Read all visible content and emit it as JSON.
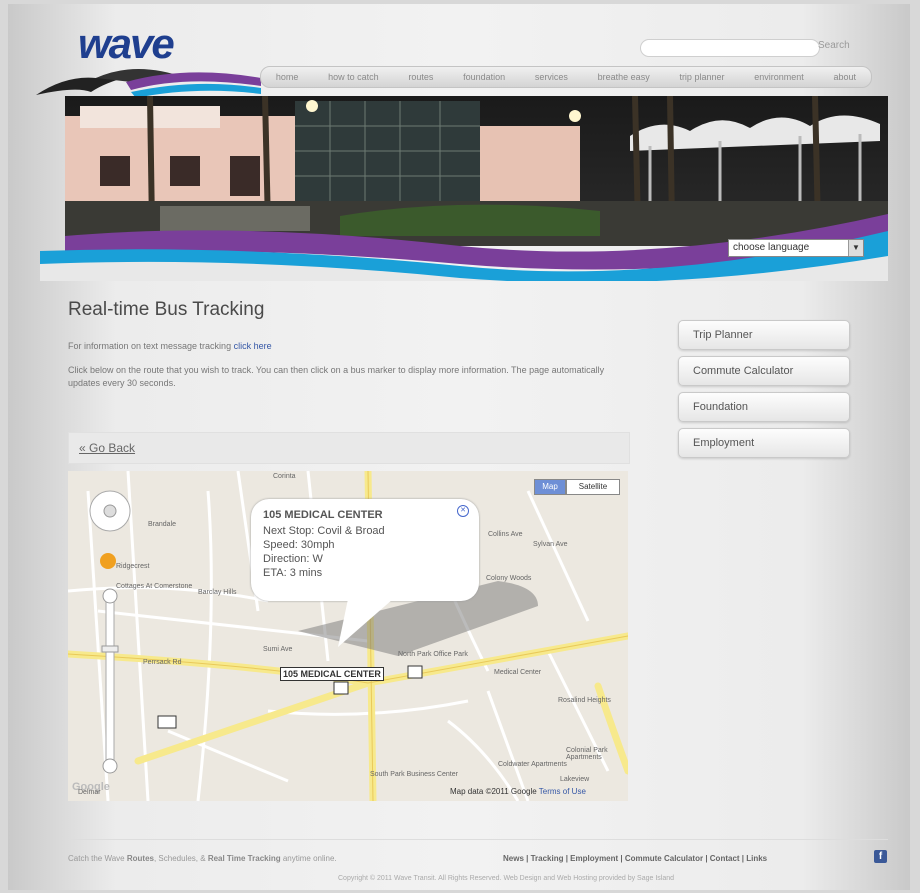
{
  "header": {
    "logo_text": "wave",
    "search_label": "Search",
    "nav_items": [
      "home",
      "how to catch",
      "routes",
      "foundation",
      "services",
      "breathe easy",
      "trip planner",
      "environment",
      "about"
    ]
  },
  "banner": {
    "language_select": "choose language"
  },
  "main": {
    "title": "Real-time Bus Tracking",
    "info_prefix": "For information on text message tracking",
    "info_link": "click here",
    "instructions": "Click below on the route that you wish to track. You can then click on a bus marker to display more information. The page automatically updates every 30 seconds.",
    "go_back": "« Go Back"
  },
  "sidebar": {
    "buttons": [
      "Trip Planner",
      "Commute Calculator",
      "Foundation",
      "Employment"
    ]
  },
  "map": {
    "map_type": [
      "Map",
      "Satellite"
    ],
    "popup": {
      "title": "105 MEDICAL CENTER",
      "next_stop": "Next Stop: Covil & Broad",
      "speed": "Speed: 30mph",
      "direction": "Direction: W",
      "eta": "ETA: 3 mins"
    },
    "bus_label": "105 MEDICAL CENTER",
    "google_logo": "Google",
    "map_data": "Map data ©2011 Google",
    "terms": "Terms of Use",
    "labels": [
      "Corinta",
      "Brandale",
      "Ridgecrest",
      "Collins Ave",
      "Colony Woods",
      "Sylvan Ave",
      "Cottages At Comerstone",
      "Barclay Hills",
      "North Park Office Park",
      "Sumi Ave",
      "Perrsack Rd",
      "Medical Center",
      "Rosalind Heights",
      "Colonial Park Apartments",
      "Coldwater Apartments",
      "South Park Business Center",
      "Lakeview",
      "Delmar"
    ]
  },
  "footer": {
    "left_prefix": "Catch the Wave",
    "left_routes": "Routes",
    "left_mid": ", Schedules, &",
    "left_tracking": "Real Time Tracking",
    "left_suffix": "anytime online.",
    "links": "News | Tracking | Employment | Commute Calculator | Contact | Links",
    "copyright": "Copyright © 2011 Wave Transit. All Rights Reserved.    Web Design and Web Hosting provided by Sage Island"
  },
  "colors": {
    "wave_blue": "#1f3f8f",
    "wave_purple": "#7a3f9a",
    "wave_cyan": "#1aa0d8",
    "road_yellow": "#f7e98c"
  }
}
